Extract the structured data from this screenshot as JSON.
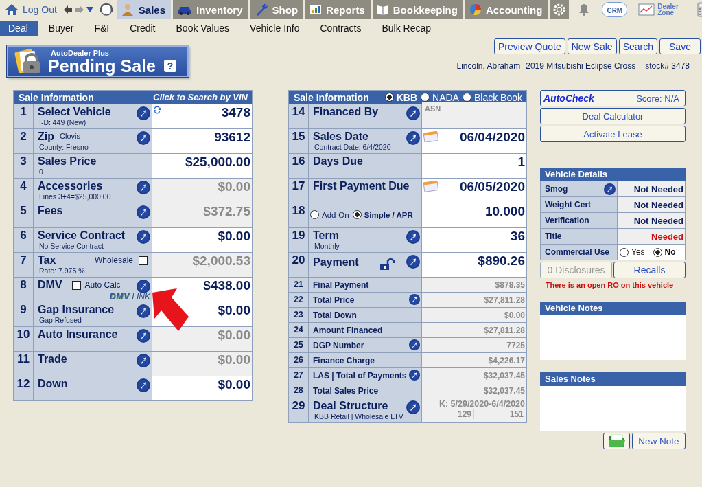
{
  "top_nav": {
    "logout": "Log Out",
    "modules": [
      {
        "label": "Sales",
        "selected": true,
        "kind": "person"
      },
      {
        "label": "Inventory",
        "selected": false,
        "kind": "car"
      },
      {
        "label": "Shop",
        "selected": false,
        "kind": "wrench"
      },
      {
        "label": "Reports",
        "selected": false,
        "kind": "chart"
      },
      {
        "label": "Bookkeeping",
        "selected": false,
        "kind": "book"
      },
      {
        "label": "Accounting",
        "selected": false,
        "kind": "pie"
      }
    ],
    "crm": "CRM",
    "dealer_zone": "Dealer Zone"
  },
  "sub_nav": [
    {
      "label": "Deal",
      "selected": true
    },
    {
      "label": "Buyer",
      "selected": false
    },
    {
      "label": "F&I",
      "selected": false
    },
    {
      "label": "Credit",
      "selected": false
    },
    {
      "label": "Book Values",
      "selected": false
    },
    {
      "label": "Vehicle Info",
      "selected": false
    },
    {
      "label": "Contracts",
      "selected": false
    },
    {
      "label": "Bulk Recap",
      "selected": false
    }
  ],
  "badge": {
    "brand": "AutoDealer Plus",
    "title": "Pending Sale",
    "help": "?"
  },
  "actions": [
    "Preview Quote",
    "New Sale",
    "Search",
    "Save"
  ],
  "customer": {
    "name": "Lincoln,  Abraham",
    "vehicle": "2019 Mitsubishi Eclipse Cross",
    "stock": "stock# 3478"
  },
  "sale_info": {
    "title": "Sale Information",
    "vin_link": "Click to Search by VIN",
    "rows": [
      {
        "number": "1",
        "label": "Select Vehicle",
        "sub": "I-D:  449  (New)",
        "link": true,
        "value": "3478",
        "kind": "editable",
        "refresh": true
      },
      {
        "number": "2",
        "label": "Zip",
        "note": "Clovis",
        "sub": "County: Fresno",
        "link": true,
        "value": "93612",
        "kind": "editable"
      },
      {
        "number": "3",
        "label": "Sales Price",
        "sub": "0",
        "link": false,
        "value": "$25,000.00",
        "kind": "editable"
      },
      {
        "number": "4",
        "label": "Accessories",
        "sub": "Lines 3+4=$25,000.00",
        "link": true,
        "value": "$0.00",
        "kind": "readonly"
      },
      {
        "number": "5",
        "label": "Fees",
        "link": true,
        "value": "$372.75",
        "kind": "readonly"
      },
      {
        "number": "6",
        "label": "Service Contract",
        "sub": "No Service Contract",
        "link": true,
        "value": "$0.00",
        "kind": "editable"
      },
      {
        "number": "7",
        "label": "Tax",
        "option": {
          "label": "Wholesale",
          "checked": false,
          "box_first": false
        },
        "sub": "Rate: 7.975 %",
        "link": false,
        "value": "$2,000.53",
        "kind": "readonly"
      },
      {
        "number": "8",
        "label": "DMV",
        "option": {
          "label": "Auto Calc",
          "checked": false,
          "box_first": true
        },
        "dmv_logo": {
          "mark": "DMV",
          "word": "LINK"
        },
        "link": true,
        "value": "$438.00",
        "kind": "editable"
      },
      {
        "number": "9",
        "label": "Gap Insurance",
        "sub": "Gap Refused",
        "link": true,
        "value": "$0.00",
        "kind": "editable"
      },
      {
        "number": "10",
        "label": "Auto Insurance",
        "link": true,
        "value": "$0.00",
        "kind": "readonly"
      },
      {
        "number": "11",
        "label": "Trade",
        "link": true,
        "value": "$0.00",
        "kind": "readonly"
      },
      {
        "number": "12",
        "label": "Down",
        "link": true,
        "value": "$0.00",
        "kind": "editable"
      }
    ]
  },
  "deal_info": {
    "title": "Sale Information",
    "book_sources": [
      {
        "label": "KBB",
        "selected": true
      },
      {
        "label": "NADA",
        "selected": false
      },
      {
        "label": "Black Book",
        "selected": false
      }
    ],
    "rows": [
      {
        "number": "14",
        "label": "Financed By",
        "link": true,
        "value": "ASN",
        "kind": "note"
      },
      {
        "number": "15",
        "label": "Sales Date",
        "sub": "Contract Date:  6/4/2020",
        "link": true,
        "calendar": true,
        "value": "06/04/2020",
        "kind": "editable"
      },
      {
        "number": "16",
        "label": "Days Due",
        "link": false,
        "value": "1",
        "kind": "editable"
      },
      {
        "number": "17",
        "label": "First Payment Due",
        "link": false,
        "calendar": true,
        "value": "06/05/2020",
        "kind": "editable"
      },
      {
        "number": "18",
        "rate_types": [
          {
            "label": "Add-On",
            "selected": false
          },
          {
            "label": "Simple / APR",
            "selected": true
          }
        ],
        "link": false,
        "value": "10.000",
        "kind": "editable"
      },
      {
        "number": "19",
        "label": "Term",
        "sub": "Monthly",
        "link": true,
        "value": "36",
        "kind": "editable"
      },
      {
        "number": "20",
        "label": "Payment",
        "locked": false,
        "link": true,
        "value": "$890.26",
        "kind": "editable"
      },
      {
        "number": "21",
        "label": "Final Payment",
        "link": false,
        "value": "$878.35",
        "kind": "summary"
      },
      {
        "number": "22",
        "label": "Total Price",
        "link": true,
        "value": "$27,811.28",
        "kind": "summary"
      },
      {
        "number": "23",
        "label": "Total Down",
        "link": false,
        "value": "$0.00",
        "kind": "summary"
      },
      {
        "number": "24",
        "label": "Amount Financed",
        "link": false,
        "value": "$27,811.28",
        "kind": "summary"
      },
      {
        "number": "25",
        "label": "DGP Number",
        "link": true,
        "value": "7725",
        "kind": "summary"
      },
      {
        "number": "26",
        "label": "Finance Charge",
        "link": false,
        "value": "$4,226.17",
        "kind": "summary"
      },
      {
        "number": "27",
        "label": "LAS | Total of Payments",
        "link": true,
        "value": "$32,037.45",
        "kind": "summary"
      },
      {
        "number": "28",
        "label": "Total Sales Price",
        "link": false,
        "value": "$32,037.45",
        "kind": "summary"
      },
      {
        "number": "29",
        "label": "Deal Structure",
        "sub": "KBB Retail | Wholesale LTV",
        "link": true,
        "value": "K: 5/29/2020-6/4/2020",
        "split": [
          "129",
          "151"
        ],
        "kind": "structure"
      }
    ]
  },
  "autocheck": {
    "brand": "AutoCheck",
    "score": "Score:  N/A"
  },
  "side_buttons": [
    "Deal Calculator",
    "Activate Lease"
  ],
  "vehicle_details": {
    "title": "Vehicle Details",
    "rows": [
      {
        "label": "Smog",
        "link": true,
        "value": "Not Needed",
        "needed": false
      },
      {
        "label": "Weight Cert",
        "link": false,
        "value": "Not Needed",
        "needed": false
      },
      {
        "label": "Verification",
        "link": false,
        "value": "Not Needed",
        "needed": false
      },
      {
        "label": "Title",
        "link": false,
        "value": "Needed",
        "needed": true
      }
    ],
    "commercial_use": {
      "label": "Commercial Use",
      "options": [
        {
          "label": "Yes",
          "selected": false
        },
        {
          "label": "No",
          "selected": true
        }
      ]
    }
  },
  "disclosures": {
    "label": "0 Disclosures",
    "disabled": true
  },
  "recalls": "Recalls",
  "alert": "There is an open RO on this vehicle",
  "vehicle_notes": {
    "title": "Vehicle Notes"
  },
  "sales_notes": {
    "title": "Sales Notes"
  },
  "new_note": "New Note"
}
